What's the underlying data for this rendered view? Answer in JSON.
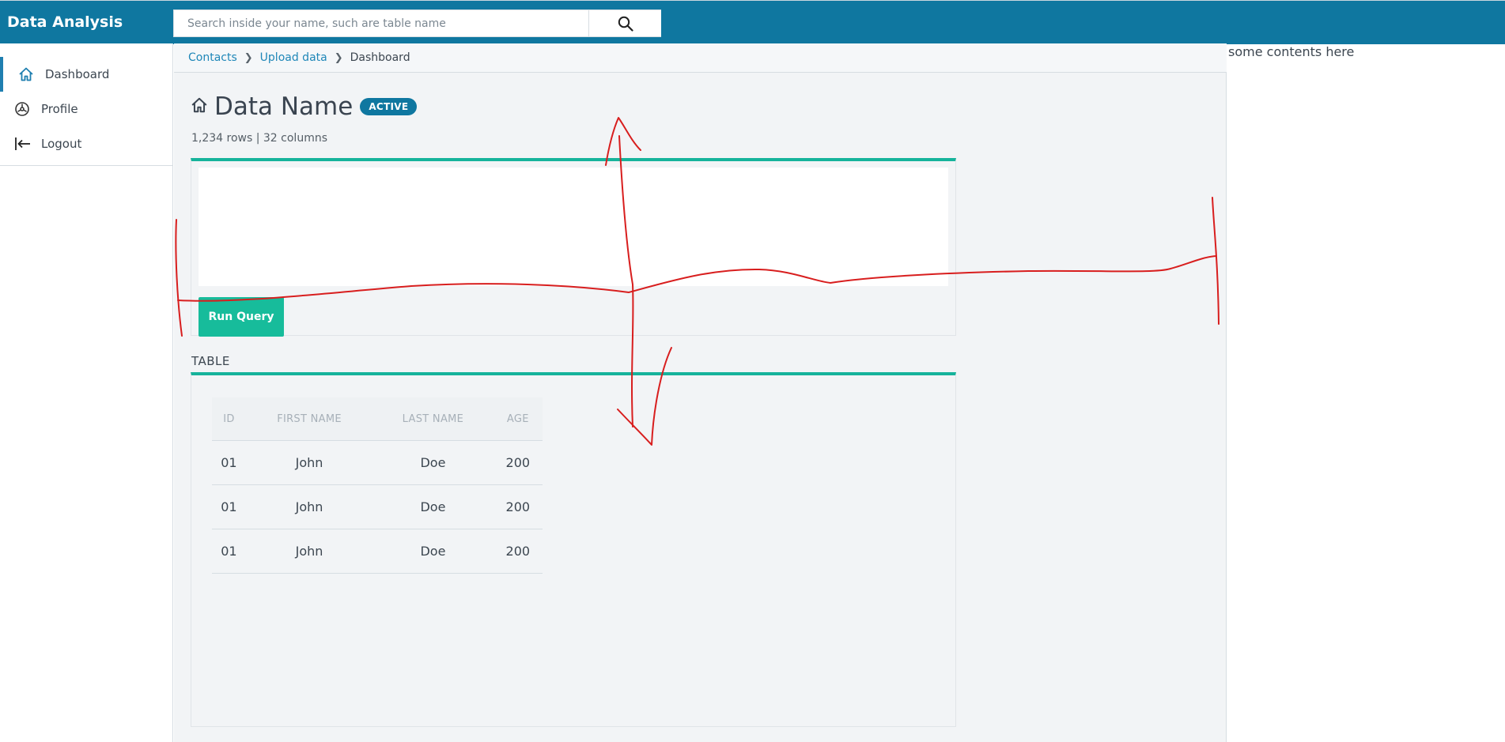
{
  "app": {
    "title": "Data Analysis"
  },
  "search": {
    "placeholder": "Search inside your name, such are table name",
    "icon": "search-icon"
  },
  "sidebar": {
    "items": [
      {
        "label": "Dashboard",
        "icon": "home-icon",
        "active": true
      },
      {
        "label": "Profile",
        "icon": "dashboard-gauge-icon",
        "active": false
      },
      {
        "label": "Logout",
        "icon": "logout-icon",
        "active": false
      }
    ]
  },
  "breadcrumb": {
    "items": [
      {
        "label": "Contacts",
        "link": true
      },
      {
        "label": "Upload data",
        "link": true
      },
      {
        "label": "Dashboard",
        "link": false
      }
    ]
  },
  "page": {
    "title": "Data Name",
    "status_badge": "ACTIVE",
    "meta": "1,234 rows | 32 columns",
    "title_icon": "home-icon"
  },
  "query": {
    "run_label": "Run Query",
    "value": ""
  },
  "table_section": {
    "label": "TABLE",
    "columns": [
      "ID",
      "FIRST NAME",
      "LAST NAME",
      "AGE"
    ],
    "rows": [
      [
        "01",
        "John",
        "Doe",
        "200"
      ],
      [
        "01",
        "John",
        "Doe",
        "200"
      ],
      [
        "01",
        "John",
        "Doe",
        "200"
      ]
    ]
  },
  "right_panel": {
    "text": "some contents here"
  },
  "colors": {
    "topbar": "#0f77a0",
    "accent": "#17bc9b",
    "link": "#1f87b8",
    "annotation": "#d81e1e"
  }
}
